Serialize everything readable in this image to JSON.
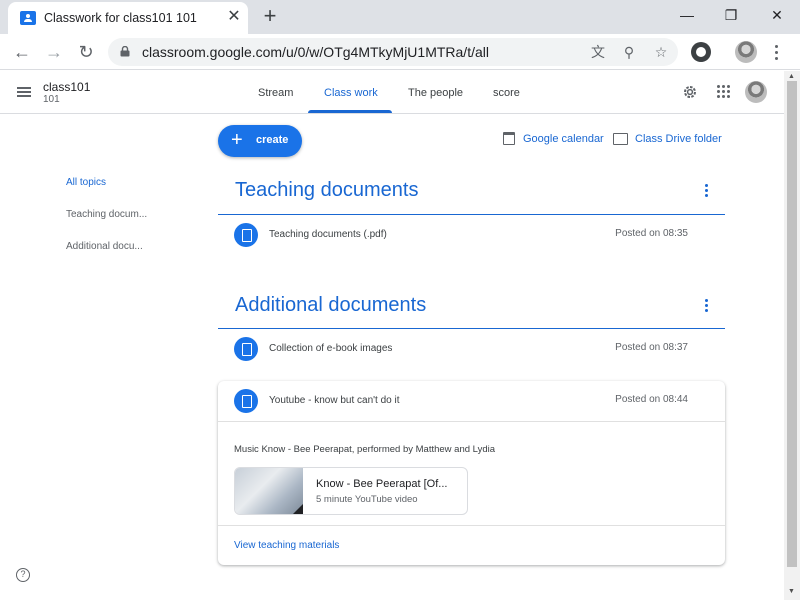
{
  "browser": {
    "tab_title": "Classwork for class101 101",
    "tab_close": "✕",
    "new_tab": "+",
    "minimize": "—",
    "restore": "❐",
    "close": "✕",
    "back": "←",
    "forward": "→",
    "reload": "↻",
    "url": "classroom.google.com/u/0/w/OTg4MTkyMjU1MTRa/t/all",
    "translate_icon": "文",
    "zoom_icon": "⚲",
    "star_icon": "☆"
  },
  "appbar": {
    "class_name": "class101",
    "class_section": "101",
    "tabs": [
      {
        "label": "Stream"
      },
      {
        "label": "Class work"
      },
      {
        "label": "The people"
      },
      {
        "label": "score"
      }
    ]
  },
  "actions": {
    "create_label": "create",
    "create_plus": "+",
    "calendar_link": "Google calendar",
    "drive_link": "Class Drive folder"
  },
  "topics": [
    {
      "label": "All topics"
    },
    {
      "label": "Teaching docum..."
    },
    {
      "label": "Additional docu..."
    }
  ],
  "sections": [
    {
      "title": "Teaching documents",
      "items": [
        {
          "title": "Teaching documents (.pdf)",
          "date": "Posted on 08:35"
        }
      ]
    },
    {
      "title": "Additional documents",
      "items": [
        {
          "title": "Collection of e-book images",
          "date": "Posted on 08:37"
        },
        {
          "title": "Youtube - know but can't do it",
          "date": "Posted on 08:44",
          "description": "Music Know - Bee Peerapat, performed by Matthew and Lydia",
          "attachment_title": "Know - Bee Peerapat [Of...",
          "attachment_sub": "5 minute YouTube video",
          "view_link": "View teaching materials"
        }
      ]
    }
  ],
  "help": "?",
  "colors": {
    "accent": "#1967d2",
    "button": "#1a73e8"
  },
  "icons": [
    "classroom-favicon",
    "lock-icon",
    "translate-icon",
    "zoom-icon",
    "star-icon",
    "extension-icon",
    "menu-icon",
    "gear-icon",
    "apps-icon",
    "calendar-icon",
    "folder-icon",
    "assignment-icon",
    "more-vert-icon",
    "help-icon"
  ]
}
